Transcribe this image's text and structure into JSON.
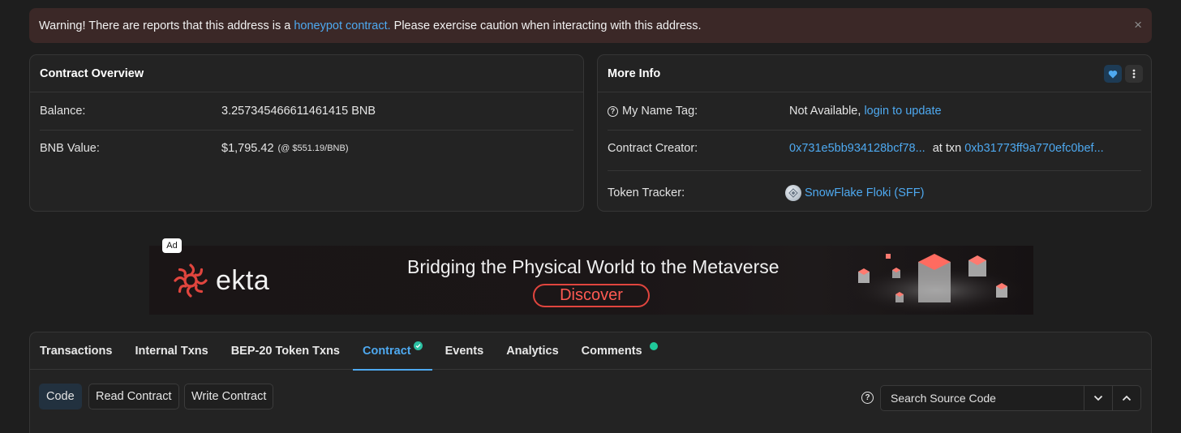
{
  "warning": {
    "prefix": "Warning! There are reports that this address is a ",
    "link": "honeypot contract.",
    "suffix": " Please exercise caution when interacting with this address.",
    "close_symbol": "×"
  },
  "overview": {
    "title": "Contract Overview",
    "balance_label": "Balance:",
    "balance_value": "3.257345466611461415 BNB",
    "value_label": "BNB Value:",
    "value_amount": "$1,795.42",
    "value_rate": "(@ $551.19/BNB)"
  },
  "more_info": {
    "title": "More Info",
    "name_tag_label": "My Name Tag:",
    "name_tag_value": "Not Available,",
    "name_tag_link": "login to update",
    "creator_label": "Contract Creator:",
    "creator_address": "0x731e5bb934128bcf78...",
    "creator_at_txn": "at txn",
    "creator_txn": "0xb31773ff9a770efc0bef...",
    "tracker_label": "Token Tracker:",
    "tracker_value": "SnowFlake Floki (SFF)"
  },
  "ad": {
    "tag": "Ad",
    "brand": "ekta",
    "headline": "Bridging the Physical World to the Metaverse",
    "cta": "Discover"
  },
  "tabs": [
    {
      "label": "Transactions"
    },
    {
      "label": "Internal Txns"
    },
    {
      "label": "BEP-20 Token Txns"
    },
    {
      "label": "Contract"
    },
    {
      "label": "Events"
    },
    {
      "label": "Analytics"
    },
    {
      "label": "Comments"
    }
  ],
  "contract_tools": {
    "code": "Code",
    "read": "Read Contract",
    "write": "Write Contract",
    "search_placeholder": "Search Source Code"
  },
  "colors": {
    "accent": "#4ea9f0",
    "verified": "#2bc0a2",
    "ad_red": "#e0453e"
  }
}
